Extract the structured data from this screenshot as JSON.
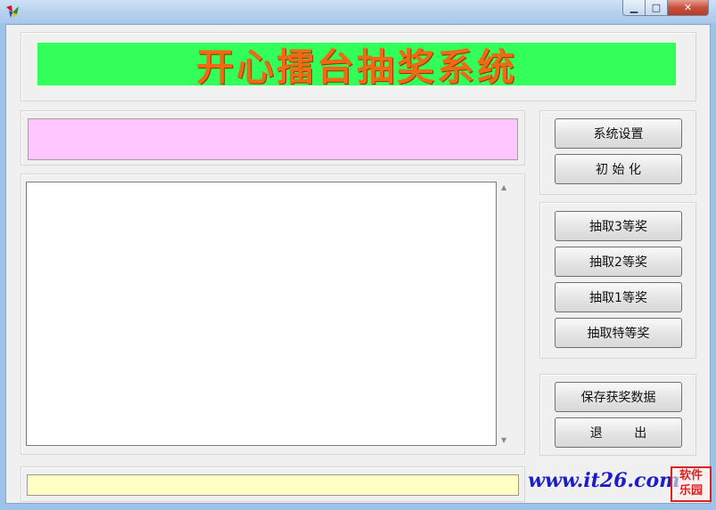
{
  "window": {
    "minimize_glyph": "▁",
    "maximize_glyph": "□",
    "close_glyph": "✕"
  },
  "banner": {
    "title": "开心擂台抽奖系统"
  },
  "buttons": {
    "settings": "系统设置",
    "init": "初 始 化",
    "draw3": "抽取3等奖",
    "draw2": "抽取2等奖",
    "draw1": "抽取1等奖",
    "draw_special": "抽取特等奖",
    "save": "保存获奖数据",
    "exit": "退        出"
  },
  "scroll": {
    "up": "▲",
    "down": "▼"
  },
  "footer": {
    "url": "www.it26.com",
    "stamp_line1": "软件",
    "stamp_line2": "乐园"
  },
  "colors": {
    "banner_bg": "#33ff5a",
    "banner_text": "#ef6a12",
    "display_pink": "#ffc6ff",
    "status_yellow": "#ffffc4",
    "url_blue": "#1d1dc8"
  },
  "icons": [
    "app-icon",
    "minimize-icon",
    "maximize-icon",
    "close-icon"
  ]
}
